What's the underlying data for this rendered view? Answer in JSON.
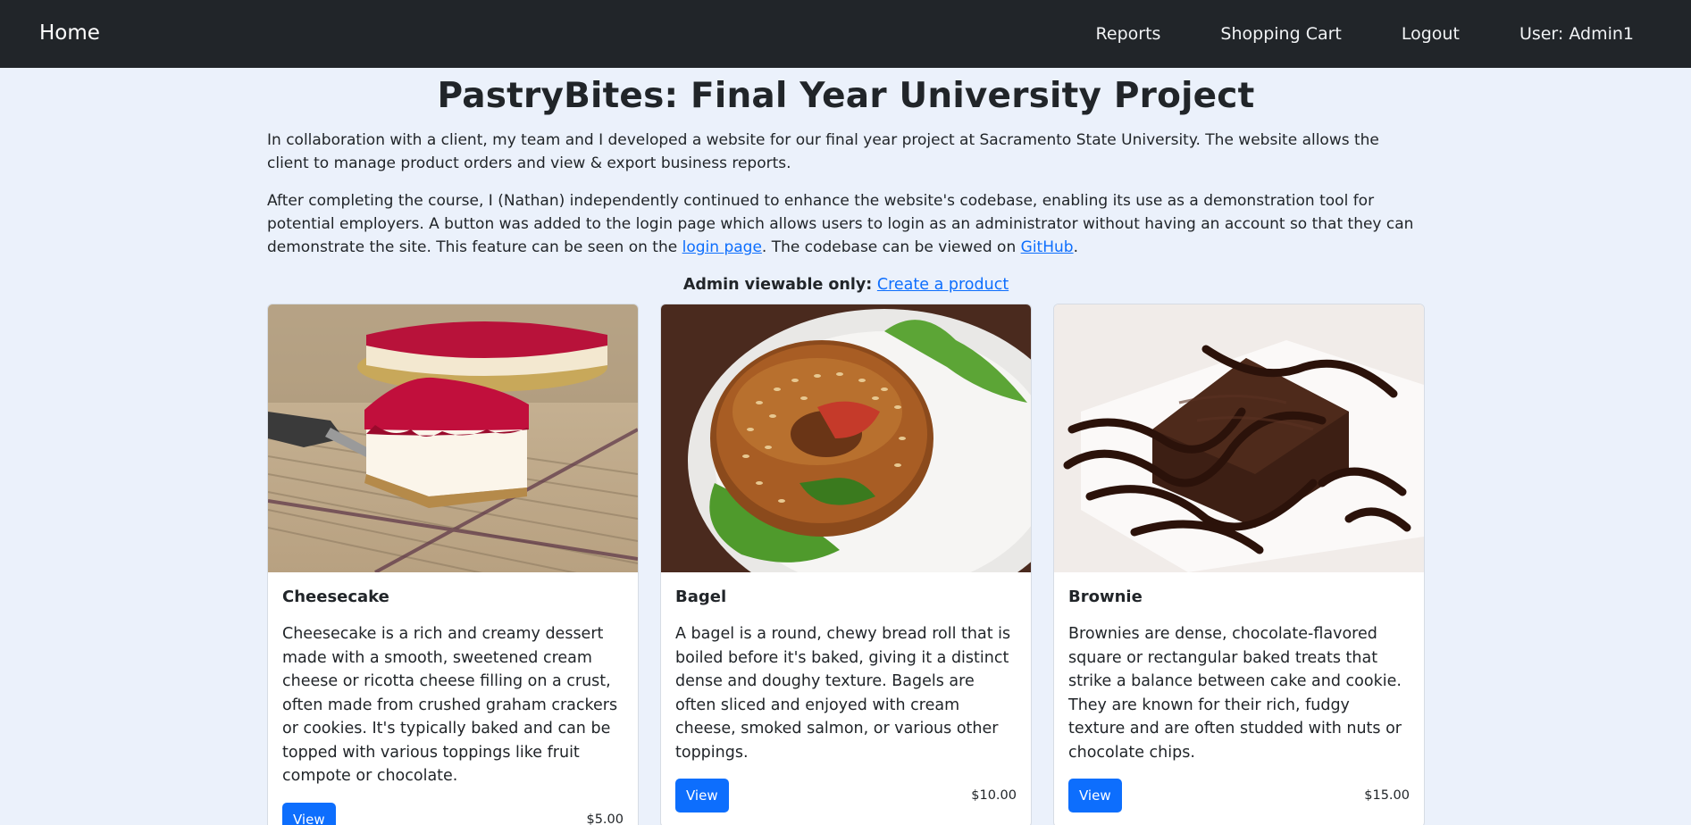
{
  "nav": {
    "brand": "Home",
    "links": [
      "Reports",
      "Shopping Cart",
      "Logout",
      "User: Admin1"
    ]
  },
  "intro": {
    "title": "PastryBites: Final Year University Project",
    "para1": "In collaboration with a client, my team and I developed a website for our final year project at Sacramento State University. The website allows the client to manage product orders and view & export business reports.",
    "para2_a": "After completing the course, I (Nathan) independently continued to enhance the website's codebase, enabling its use as a demonstration tool for potential employers. A button was added to the login page which allows users to login as an administrator without having an account so that they can demonstrate the site. This feature can be seen on the ",
    "login_link": "login page",
    "para2_b": ". The codebase can be viewed on ",
    "github_link": "GitHub",
    "para2_c": ".",
    "admin_label": "Admin viewable only:",
    "admin_link": "Create a product"
  },
  "products": [
    {
      "name": "Cheesecake",
      "description": "Cheesecake is a rich and creamy dessert made with a smooth, sweetened cream cheese or ricotta cheese filling on a crust, often made from crushed graham crackers or cookies. It's typically baked and can be topped with various toppings like fruit compote or chocolate.",
      "button": "View",
      "price": "$5.00",
      "image": "cheesecake-photo"
    },
    {
      "name": "Bagel",
      "description": "A bagel is a round, chewy bread roll that is boiled before it's baked, giving it a distinct dense and doughy texture. Bagels are often sliced and enjoyed with cream cheese, smoked salmon, or various other toppings.",
      "button": "View",
      "price": "$10.00",
      "image": "bagel-photo"
    },
    {
      "name": "Brownie",
      "description": "Brownies are dense, chocolate-flavored square or rectangular baked treats that strike a balance between cake and cookie. They are known for their rich, fudgy texture and are often studded with nuts or chocolate chips.",
      "button": "View",
      "price": "$15.00",
      "image": "brownie-photo"
    }
  ],
  "colors": {
    "navbar": "#212529",
    "background": "#ebf1fb",
    "primary": "#0d6efd"
  }
}
